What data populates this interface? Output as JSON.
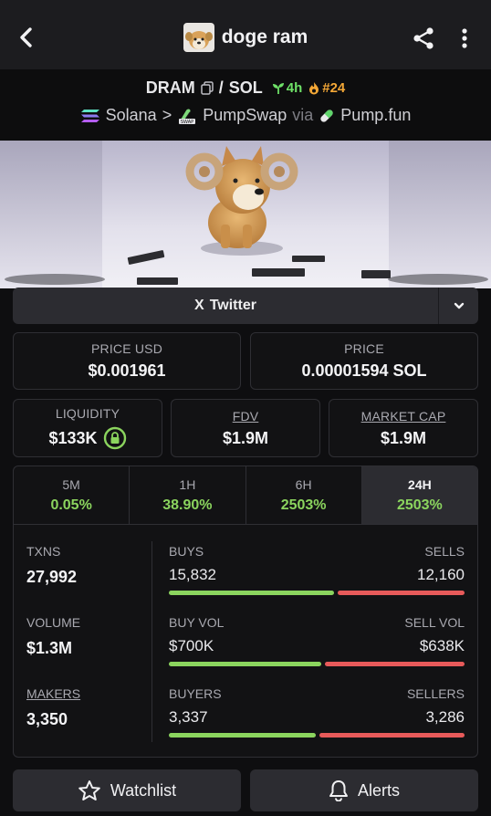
{
  "header": {
    "title": "doge ram",
    "back_icon": "chevron-left-icon",
    "share_icon": "share-icon",
    "more_icon": "more-vertical-icon"
  },
  "pair": {
    "base": "DRAM",
    "separator": "/",
    "quote": "SOL",
    "age": "4h",
    "rank": "#24",
    "age_color": "#6ee067",
    "rank_color": "#f3a736"
  },
  "route": {
    "chain": "Solana",
    "arrow": ">",
    "dex": "PumpSwap",
    "via": "via",
    "launchpad": "Pump.fun"
  },
  "social": {
    "label": "Twitter",
    "x_glyph": "X"
  },
  "price": {
    "usd_label": "PRICE USD",
    "usd_value": "$0.001961",
    "native_label": "PRICE",
    "native_value": "0.00001594 SOL"
  },
  "metrics": {
    "liquidity_label": "LIQUIDITY",
    "liquidity_value": "$133K",
    "fdv_label": "FDV",
    "fdv_value": "$1.9M",
    "mcap_label": "MARKET CAP",
    "mcap_value": "$1.9M"
  },
  "tabs": [
    {
      "label": "5M",
      "value": "0.05%"
    },
    {
      "label": "1H",
      "value": "38.90%"
    },
    {
      "label": "6H",
      "value": "2503%"
    },
    {
      "label": "24H",
      "value": "2503%"
    }
  ],
  "active_tab": "24H",
  "stats": {
    "txns_label": "TXNS",
    "txns_value": "27,992",
    "volume_label": "VOLUME",
    "volume_value": "$1.3M",
    "makers_label": "MAKERS",
    "makers_value": "3,350",
    "buys_label": "BUYS",
    "buys_value": "15,832",
    "sells_label": "SELLS",
    "sells_value": "12,160",
    "buys_fraction": 0.566,
    "buyvol_label": "BUY VOL",
    "buyvol_value": "$700K",
    "sellvol_label": "SELL VOL",
    "sellvol_value": "$638K",
    "buyvol_fraction": 0.523,
    "buyers_label": "BUYERS",
    "buyers_value": "3,337",
    "sellers_label": "SELLERS",
    "sellers_value": "3,286",
    "buyers_fraction": 0.504
  },
  "actions": {
    "watchlist": "Watchlist",
    "alerts": "Alerts"
  },
  "colors": {
    "positive": "#8bd45e",
    "negative": "#e75a5a",
    "panel": "#2c2c31",
    "background": "#0e0e10"
  }
}
